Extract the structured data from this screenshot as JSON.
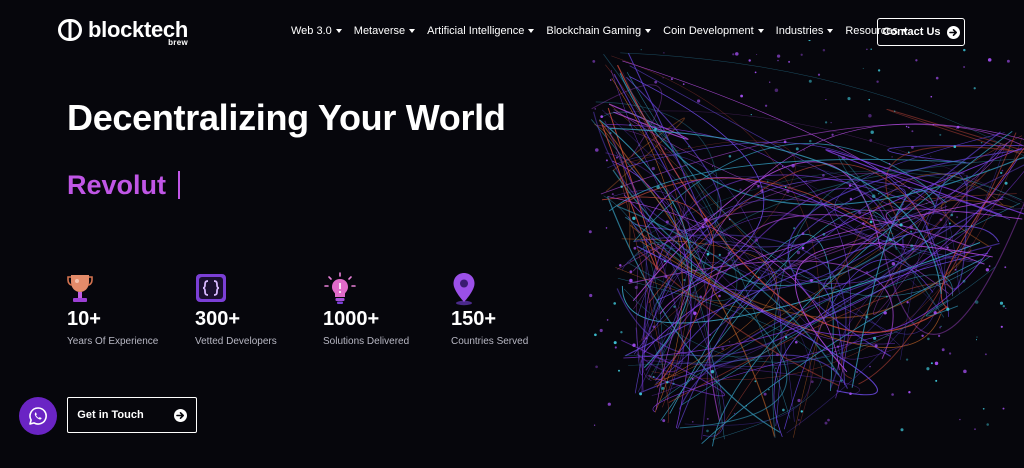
{
  "brand": {
    "name": "blocktech",
    "sub": "brew"
  },
  "nav": {
    "items": [
      {
        "label": "Web 3.0"
      },
      {
        "label": "Metaverse"
      },
      {
        "label": "Artificial Intelligence"
      },
      {
        "label": "Blockchain Gaming"
      },
      {
        "label": "Coin Development"
      },
      {
        "label": "Industries"
      },
      {
        "label": "Resources"
      }
    ],
    "contact_label": "Contact Us"
  },
  "hero": {
    "headline": "Decentralizing Your World",
    "rotating_word": "Revolut"
  },
  "stats": [
    {
      "icon": "trophy-icon",
      "value": "10+",
      "label": "Years Of Experience"
    },
    {
      "icon": "code-braces-icon",
      "value": "300+",
      "label": "Vetted Developers"
    },
    {
      "icon": "lightbulb-icon",
      "value": "1000+",
      "label": "Solutions Delivered"
    },
    {
      "icon": "location-pin-icon",
      "value": "150+",
      "label": "Countries Served"
    }
  ],
  "cta": {
    "label": "Get in Touch"
  },
  "colors": {
    "accent": "#c056e6",
    "background": "#06060c",
    "whatsapp": "#6a24c4"
  }
}
